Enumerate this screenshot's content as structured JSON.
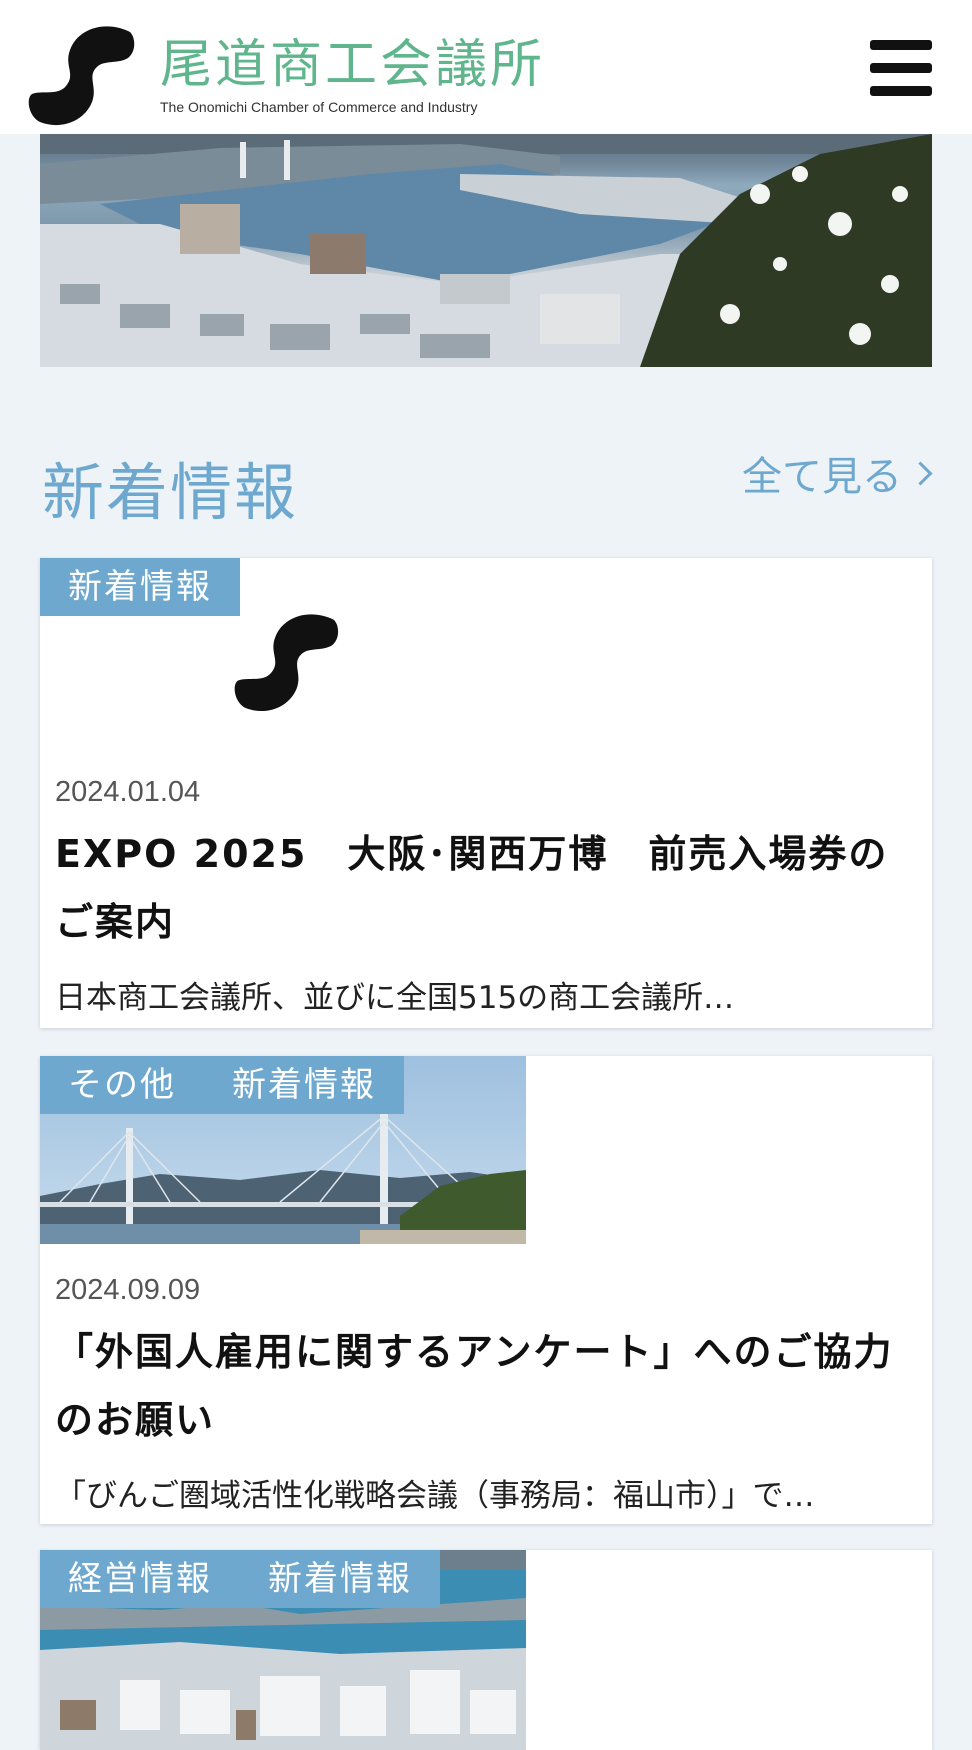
{
  "header": {
    "title": "尾道商工会議所",
    "subtitle": "The Onomichi Chamber of Commerce and Industry"
  },
  "section": {
    "title": "新着情報",
    "view_all": "全て見る"
  },
  "colors": {
    "accent": "#6ea8cf",
    "title_green": "#5fb58c",
    "background": "#eef3f8"
  },
  "posts": [
    {
      "tags": [
        "新着情報"
      ],
      "date": "2024.01.04",
      "title": "EXPO 2025　大阪･関西万博　前売入場券のご案内",
      "excerpt": "日本商工会議所、並びに全国515の商工会議所…",
      "thumbnail": "chamber-logo"
    },
    {
      "tags": [
        "その他",
        "新着情報"
      ],
      "date": "2024.09.09",
      "title": "「外国人雇用に関するアンケート」へのご協力のお願い",
      "excerpt": "「びんご圏域活性化戦略会議（事務局：福山市）」で…",
      "thumbnail": "bridge-photo"
    },
    {
      "tags": [
        "経営情報",
        "新着情報"
      ],
      "thumbnail": "harbor-photo"
    }
  ]
}
